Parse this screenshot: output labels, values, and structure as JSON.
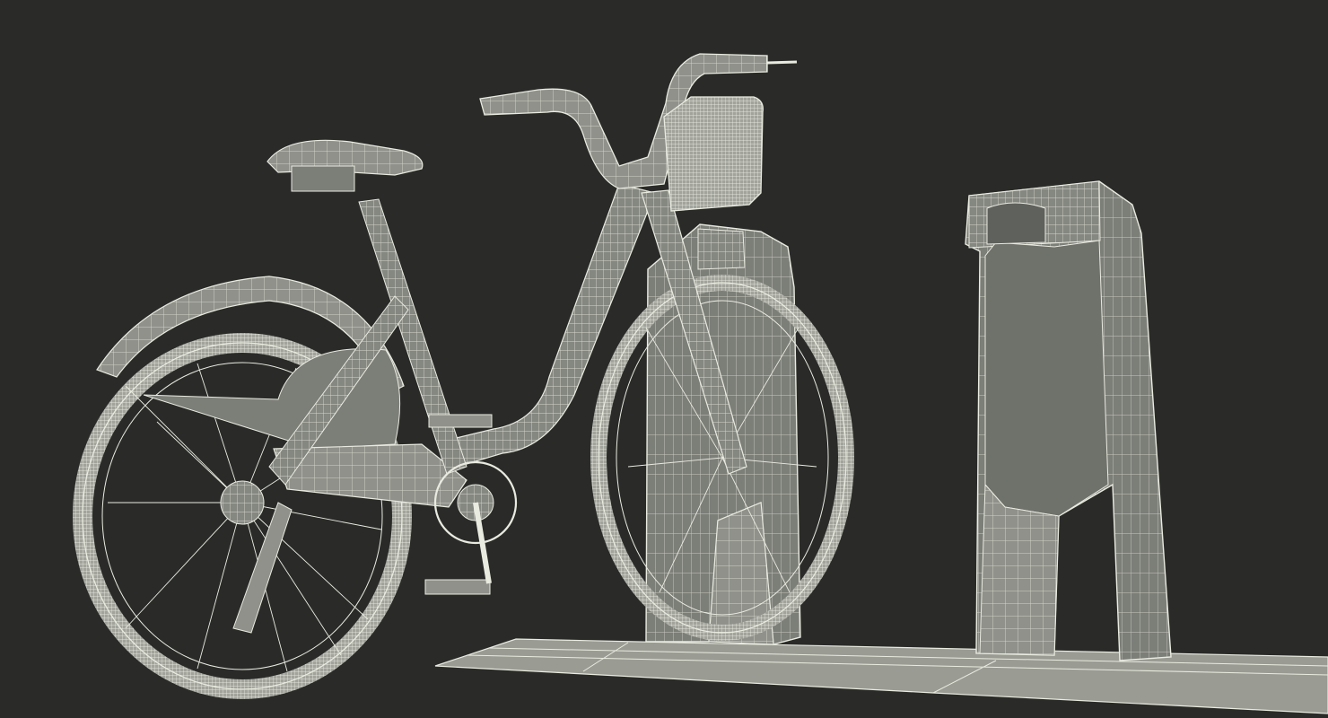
{
  "scene": {
    "background_color": "#2a2b29",
    "model_fill_color": "#8f918a",
    "model_fill_dark": "#6f716b",
    "wire_color": "#e9ebe0",
    "objects": [
      "bike-share-bicycle",
      "docking-post-with-bike",
      "empty-docking-post",
      "base-plate"
    ]
  }
}
